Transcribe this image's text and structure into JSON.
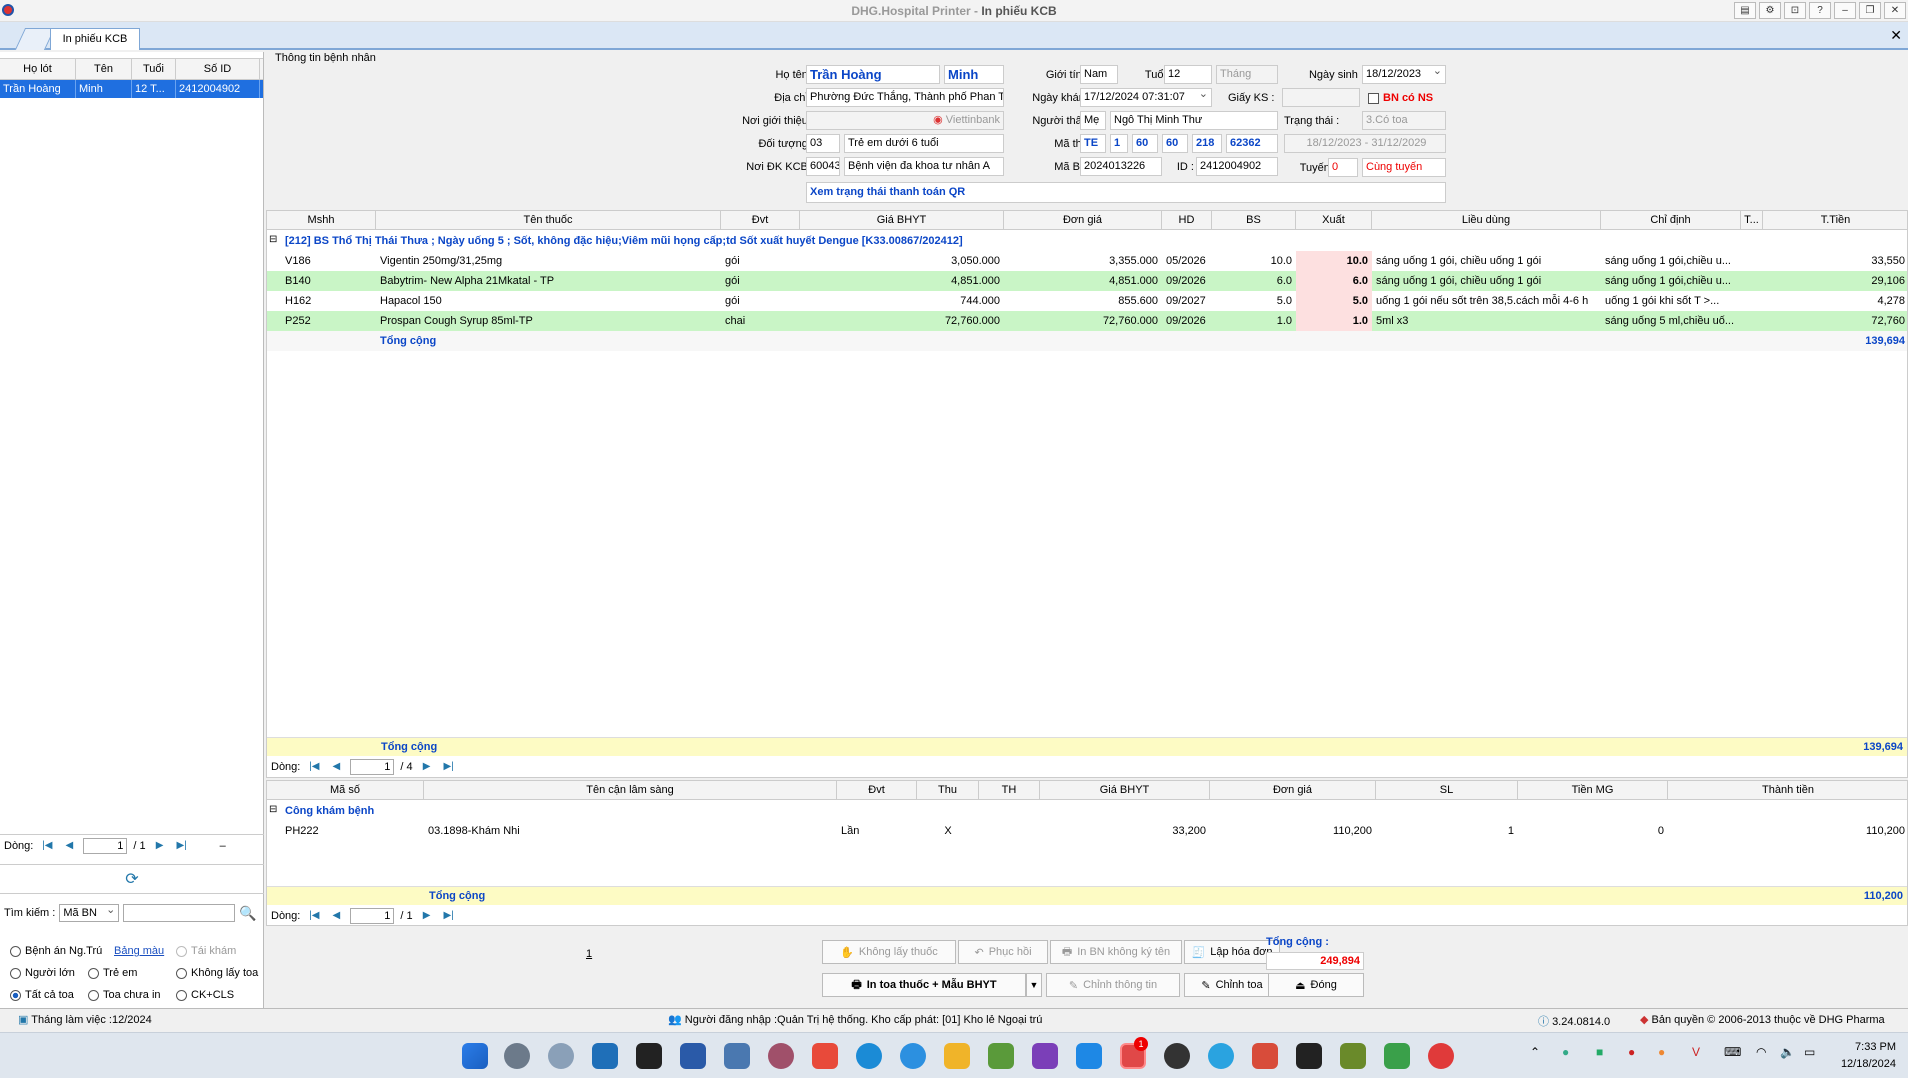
{
  "window": {
    "app_name": "DHG.Hospital Printer",
    "separator": " - ",
    "screen_name": "In phiếu KCB"
  },
  "tab": {
    "label": "In phiếu KCB"
  },
  "left": {
    "headers": [
      "Họ lót",
      "Tên",
      "Tuổi",
      "Số ID"
    ],
    "rows": [
      [
        "Trần Hoàng",
        "Minh",
        "12 T...",
        "2412004902"
      ]
    ],
    "nav_label": "Dòng:",
    "nav_page": "1",
    "nav_total": "/ 1",
    "nav_minus": "–",
    "search_label": "Tìm kiếm :",
    "search_option": "Mã BN",
    "radios": {
      "benh_an": "Bệnh án Ng.Trú",
      "bang_mau": "Bảng màu",
      "tai_kham": "Tái khám",
      "nguoi_lon": "Người lớn",
      "tre_em": "Trẻ em",
      "khong_lay_toa": "Không lấy toa",
      "tat_ca_toa": "Tất cả toa",
      "toa_chua_in": "Toa chưa in",
      "ck_cls": "CK+CLS"
    }
  },
  "patient": {
    "section_title": "Thông tin bệnh nhân",
    "ho_ten_label": "Họ tên :",
    "ho_lot": "Trần Hoàng",
    "ten": "Minh",
    "gioi_tinh_label": "Giới tính :",
    "gioi_tinh": "Nam",
    "tuoi_label": "Tuổi :",
    "tuoi": "12",
    "tuoi_unit": "Tháng",
    "ngay_sinh_label": "Ngày sinh :",
    "ngay_sinh": "18/12/2023",
    "dia_chi_label": "Địa chỉ :",
    "dia_chi": "Phường Đức Thắng, Thành phố Phan Th",
    "ngay_kham_label": "Ngày khám :",
    "ngay_kham": "17/12/2024 07:31:07",
    "giay_ks_label": "Giấy KS :",
    "bn_co_ns": "BN có NS",
    "noi_gioi_thieu_label": "Nơi giới thiệu :",
    "bank": "Viettinbank",
    "nguoi_than_label": "Người thân :",
    "quan_he": "Mẹ",
    "nguoi_than": "Ngô Thị Minh Thư",
    "trang_thai_label": "Trạng thái :",
    "trang_thai": "3.Có toa",
    "doi_tuong_label": "Đối tượng :",
    "doi_tuong_code": "03",
    "doi_tuong": "Trẻ em dưới 6 tuổi",
    "ma_the_label": "Mã thẻ :",
    "ma_the": [
      "TE",
      "1",
      "60",
      "60",
      "218",
      "62362"
    ],
    "the_han": "18/12/2023 - 31/12/2029",
    "noi_dk_label": "Nơi ĐK KCB :",
    "noi_dk_code": "60043",
    "noi_dk": "Bệnh viện đa khoa tư nhân A",
    "ma_bn_label": "Mã BN :",
    "ma_bn": "2024013226",
    "id_label": "ID :",
    "id": "2412004902",
    "tuyen_label": "Tuyến :",
    "tuyen_code": "0",
    "tuyen": "Cùng tuyến",
    "qr_text": "Xem trạng thái thanh toán QR"
  },
  "drugs": {
    "headers": [
      "Mshh",
      "Tên thuốc",
      "Đvt",
      "Giá BHYT",
      "Đơn giá",
      "HD",
      "BS",
      "Xuất",
      "Liều dùng",
      "Chỉ định",
      "T...",
      "T.Tiền"
    ],
    "group_title": "[212] BS Thổ Thị Thái Thưa ; Ngày uống 5 ; Sốt, không đặc hiệu;Viêm mũi họng cấp;td Sốt xuất huyết Dengue [K33.00867/202412]",
    "rows": [
      {
        "mshh": "V186",
        "ten": "Vigentin 250mg/31,25mg",
        "dvt": "gói",
        "gia_bhyt": "3,050.000",
        "don_gia": "3,355.000",
        "hd": "05/2026",
        "bs": "10.0",
        "xuat": "10.0",
        "lieu_dung": "sáng uống 1 gói, chiều uống 1 gói",
        "chi_dinh": "sáng uống 1 gói,chiều u...",
        "t": "",
        "t_tien": "33,550"
      },
      {
        "mshh": "B140",
        "ten": "Babytrim- New Alpha 21Mkatal - TP",
        "dvt": "gói",
        "gia_bhyt": "4,851.000",
        "don_gia": "4,851.000",
        "hd": "09/2026",
        "bs": "6.0",
        "xuat": "6.0",
        "lieu_dung": "sáng uống 1 gói, chiều uống 1 gói",
        "chi_dinh": "sáng uống 1 gói,chiều u...",
        "t": "",
        "t_tien": "29,106"
      },
      {
        "mshh": "H162",
        "ten": "Hapacol 150",
        "dvt": "gói",
        "gia_bhyt": "744.000",
        "don_gia": "855.600",
        "hd": "09/2027",
        "bs": "5.0",
        "xuat": "5.0",
        "lieu_dung": "uống 1 gói nếu sốt trên 38,5.cách mỗi 4-6 h",
        "chi_dinh": "uống  1  gói khi sốt T >...",
        "t": "",
        "t_tien": "4,278"
      },
      {
        "mshh": "P252",
        "ten": "Prospan Cough Syrup 85ml-TP",
        "dvt": "chai",
        "gia_bhyt": "72,760.000",
        "don_gia": "72,760.000",
        "hd": "09/2026",
        "bs": "1.0",
        "xuat": "1.0",
        "lieu_dung": "5ml x3",
        "chi_dinh": "sáng uống 5 ml,chiều uố...",
        "t": "",
        "t_tien": "72,760"
      }
    ],
    "subtotal_label": "Tổng cộng",
    "subtotal": "139,694",
    "footer_label": "Tổng cộng",
    "footer_total": "139,694",
    "nav_label": "Dòng:",
    "nav_page": "1",
    "nav_total": "/ 4"
  },
  "services": {
    "headers": [
      "Mã số",
      "Tên cận lâm sàng",
      "Đvt",
      "Thu",
      "TH",
      "Giá BHYT",
      "Đơn giá",
      "SL",
      "Tiền MG",
      "Thành tiền"
    ],
    "group_title": "Công khám bệnh",
    "rows": [
      {
        "ma": "PH222",
        "ten": "03.1898-Khám Nhi",
        "dvt": "Lần",
        "thu": "X",
        "th": "",
        "gia_bhyt": "33,200",
        "don_gia": "110,200",
        "sl": "1",
        "tien_mg": "0",
        "thanh_tien": "110,200"
      }
    ],
    "footer_label": "Tổng cộng",
    "footer_total": "110,200",
    "nav_label": "Dòng:",
    "nav_page": "1",
    "nav_total": "/ 1"
  },
  "actions": {
    "page_num": "1",
    "khong_lay_thuoc": "Không lấy thuốc",
    "phuc_hoi": "Phục hồi",
    "in_bn_khong_ky_ten": "In BN không ký tên",
    "lap_hoa_don": "Lập hóa đơn",
    "in_toa_thuoc": "In toa thuốc + Mẫu BHYT",
    "chinh_thong_tin": "Chỉnh thông tin",
    "chinh_toa": "Chỉnh toa",
    "dong": "Đóng",
    "tong_cong_label": "Tổng cộng :",
    "tong_cong": "249,894"
  },
  "status": {
    "thang_lam_viec": "Tháng làm việc :12/2024",
    "nguoi_dang_nhap": "Người đăng nhập :Quản Trị hệ thống. Kho cấp phát: [01] Kho lẻ Ngoại trú",
    "version": "3.24.0814.0",
    "copyright": "Bản quyền © 2006-2013 thuộc về DHG Pharma"
  },
  "taskbar": {
    "time": "7:33 PM",
    "date": "12/18/2024",
    "notif_badge": "1"
  }
}
